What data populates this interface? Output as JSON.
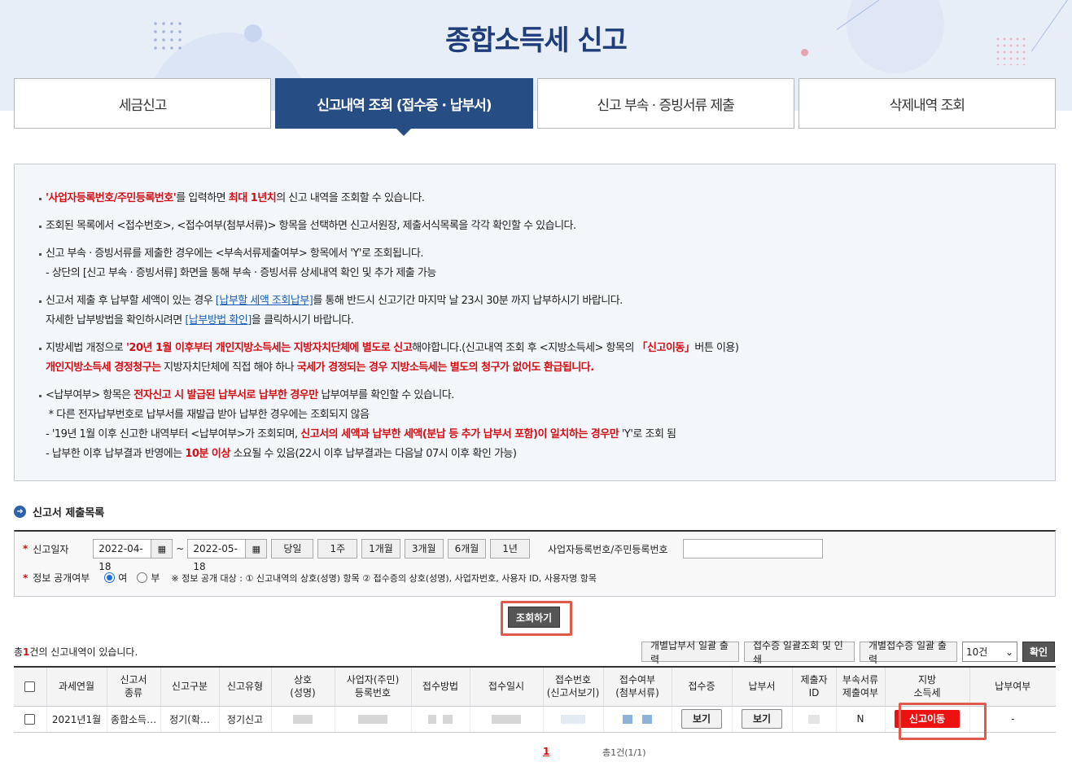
{
  "header": {
    "title": "종합소득세 신고"
  },
  "tabs": [
    {
      "label": "세금신고"
    },
    {
      "label": "신고내역 조회 (접수증 · 납부서)"
    },
    {
      "label": "신고 부속 · 증빙서류 제출"
    },
    {
      "label": "삭제내역 조회"
    }
  ],
  "info": {
    "l1a": "'사업자등록번호/주민등록번호'",
    "l1b": "를 입력하면 ",
    "l1c": "최대 1년치",
    "l1d": "의 신고 내역을 조회할 수 있습니다.",
    "l2": "조회된 목록에서 <접수번호>, <접수여부(첨부서류)> 항목을 선택하면 신고서원장, 제출서식목록을 각각 확인할 수 있습니다.",
    "l3": "신고 부속 · 증빙서류를 제출한 경우에는 <부속서류제출여부> 항목에서 'Y'로 조회됩니다.",
    "l3b": "- 상단의 [신고 부속 · 증빙서류] 화면을 통해 부속 · 증빙서류 상세내역 확인 및 추가 제출 가능",
    "l4a": "신고서 제출 후 납부할 세액이 있는 경우 ",
    "l4link": "[납부할 세액 조회납부]",
    "l4b": "를 통해 반드시 신고기간 마지막 날 23시 30분 까지 납부하시기 바랍니다.",
    "l4c": "자세한 납부방법을 확인하시려면 ",
    "l4link2": "[납부방법 확인]",
    "l4d": "을 클릭하시기 바랍니다.",
    "l5a": "지방세법 개정으로 ",
    "l5b": "'20년 1월 이후부터 개인지방소득세는 지방자치단체에 별도로 신고",
    "l5c": "해야합니다.(신고내역 조회 후 <지방소득세> 항목의 ",
    "l5d": "「신고이동」",
    "l5e": "버튼 이용)",
    "l5f": "개인지방소득세 경정청구는",
    "l5g": " 지방자치단체에 직접 해야 하나 ",
    "l5h": "국세가 경정되는 경우 지방소득세는 별도의 청구가 없어도 환급됩니다.",
    "l6a": "<납부여부> 항목은 ",
    "l6b": "전자신고 시 발급된 납부서로 납부한 경우만",
    "l6c": " 납부여부를 확인할 수 있습니다.",
    "l6d": "* 다른 전자납부번호로 납부서를 재발급 받아 납부한 경우에는 조회되지 않음",
    "l6e": "- '19년 1월 이후 신고한 내역부터 <납부여부>가 조회되며, ",
    "l6f": "신고서의 세액과 납부한 세액(분납 등 추가 납부서 포함)이 일치하는 경우만",
    "l6g": " 'Y'로 조회 됨",
    "l6h": "- 납부한 이후 납부결과 반영에는 ",
    "l6i": "10분 이상",
    "l6j": " 소요될 수 있음(22시 이후 납부결과는 다음날 07시 이후 확인 가능)"
  },
  "section": {
    "title": "신고서 제출목록"
  },
  "search": {
    "date_label": "신고일자",
    "date_from": "2022-04-18",
    "date_to": "2022-05-18",
    "tilde": "~",
    "periods": [
      "당일",
      "1주",
      "1개월",
      "3개월",
      "6개월",
      "1년"
    ],
    "id_label": "사업자등록번호/주민등록번호",
    "id_value": "",
    "public_label": "정보 공개여부",
    "yes": "여",
    "no": "부",
    "public_note": "※ 정보 공개 대상 : ① 신고내역의 상호(성명) 항목 ② 접수증의 상호(성명), 사업자번호, 사용자 ID, 사용자명 항목",
    "search_button": "조회하기"
  },
  "results": {
    "prefix": "총",
    "count": "1",
    "suffix": "건의 신고내역이 있습니다.",
    "btn_bulk_pay": "개별납부서 일괄 출력",
    "btn_bulk_receipt": "접수증 일괄조회 및 인쇄",
    "btn_bulk_individual": "개별접수증 일괄 출력",
    "page_size": "10건",
    "confirm": "확인"
  },
  "table": {
    "headers": [
      "",
      "과세연월",
      "신고서\n종류",
      "신고구분",
      "신고유형",
      "상호\n(성명)",
      "사업자(주민)\n등록번호",
      "접수방법",
      "접수일시",
      "접수번호\n(신고서보기)",
      "접수여부\n(첨부서류)",
      "접수증",
      "납부서",
      "제출자\nID",
      "부속서류\n제출여부",
      "지방\n소득세",
      "납부여부"
    ],
    "rows": [
      {
        "period": "2021년1월",
        "kind": "종합소득…",
        "category": "정기(확…",
        "type": "정기신고",
        "view1": "보기",
        "view2": "보기",
        "attach": "N",
        "local": "신고이동",
        "paid": "-"
      }
    ]
  },
  "pager": {
    "current": "1",
    "total": "총1건(1/1)"
  }
}
